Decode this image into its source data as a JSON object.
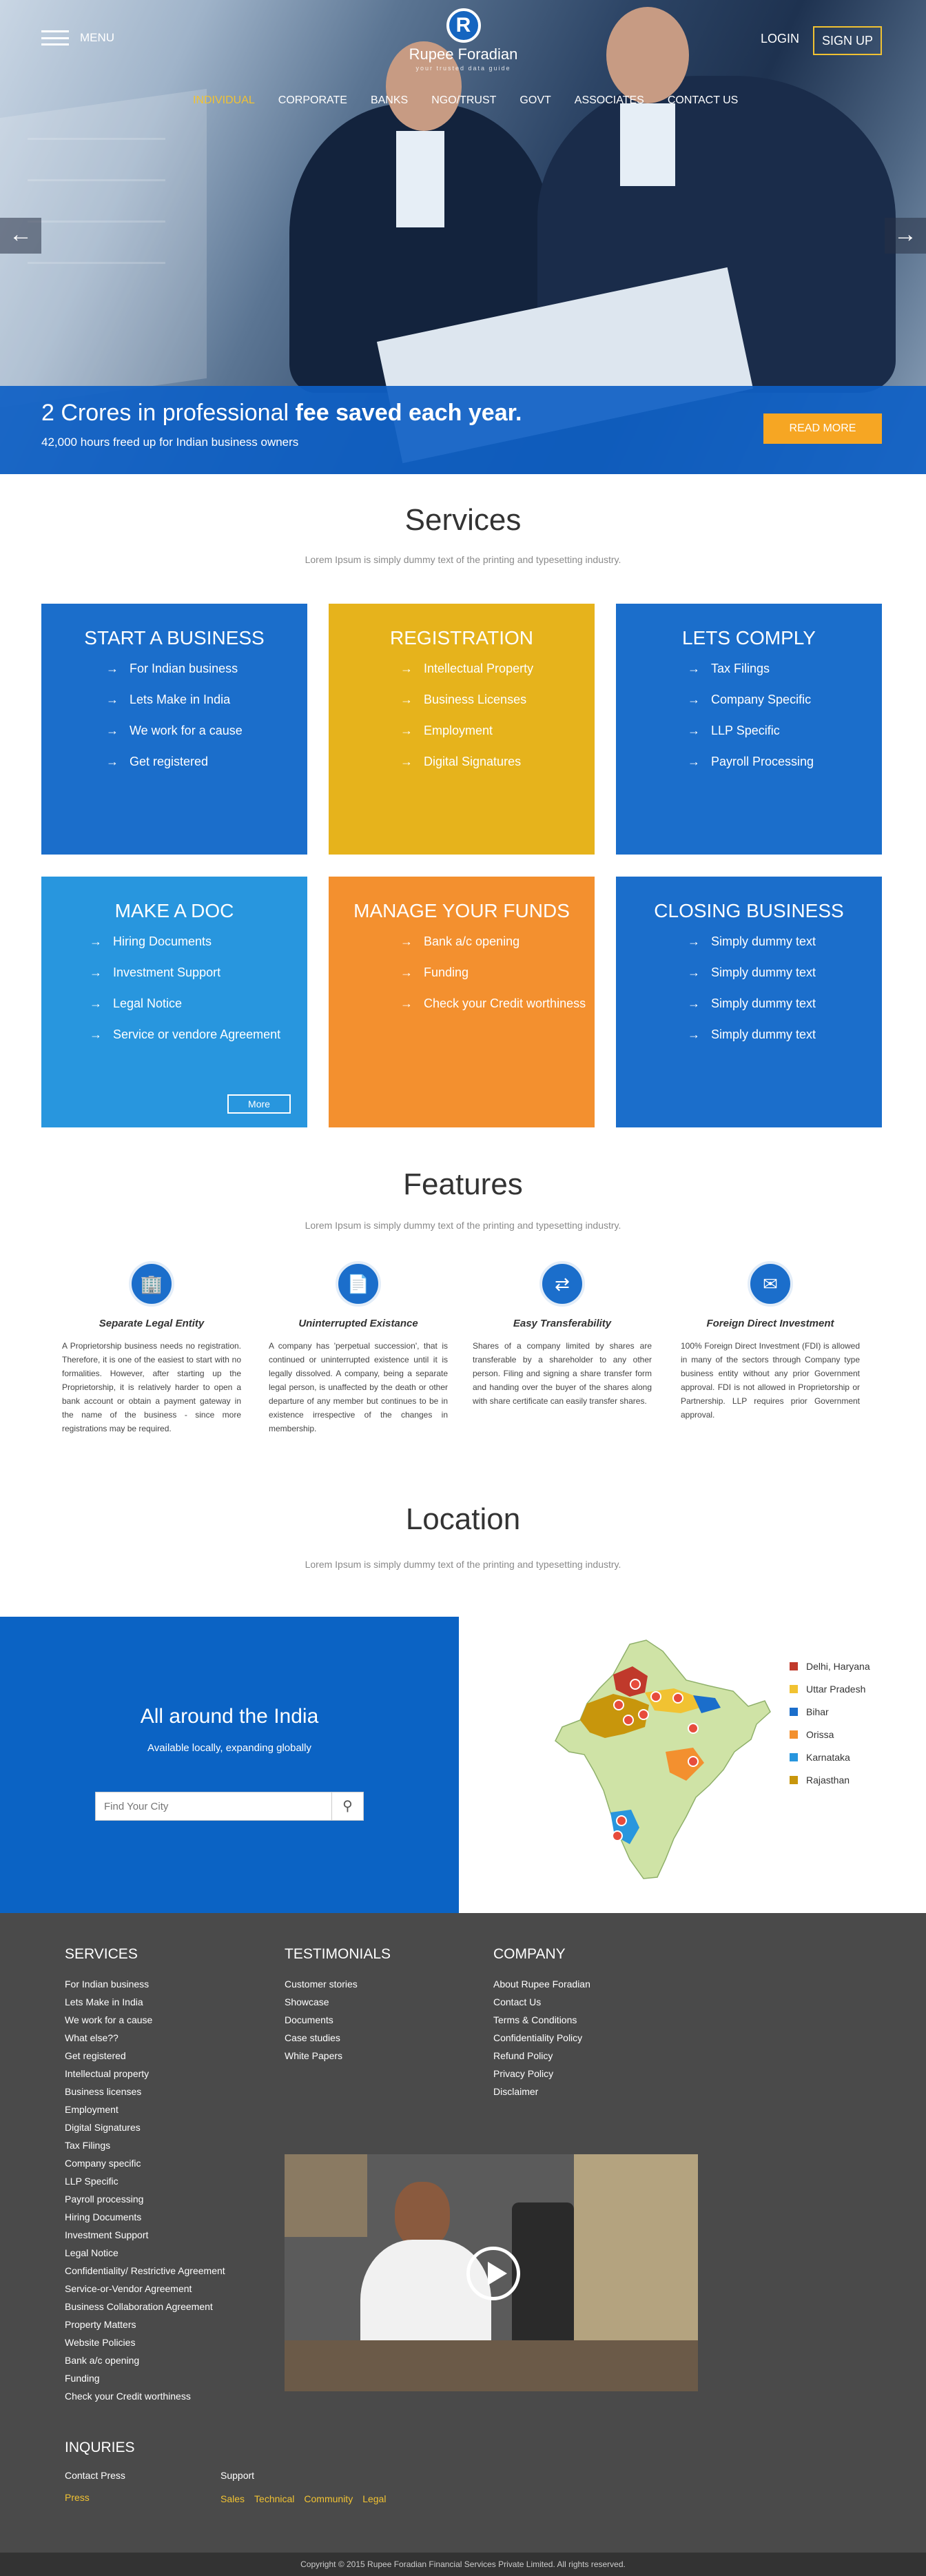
{
  "header": {
    "menu_label": "MENU",
    "logo_letter": "R",
    "logo_name": "Rupee Foradian",
    "logo_tagline": "your trusted data guide",
    "login": "LOGIN",
    "signup": "SIGN UP"
  },
  "nav": {
    "items": [
      "INDIVIDUAL",
      "CORPORATE",
      "BANKS",
      "NGO/TRUST",
      "GOVT",
      "ASSOCIATES",
      "CONTACT US"
    ],
    "active": "INDIVIDUAL"
  },
  "banner": {
    "headline_light": "2 Crores in professional",
    "headline_bold": "fee saved each year.",
    "subtext": "42,000 hours freed up for Indian business owners",
    "cta": "READ MORE"
  },
  "services": {
    "title": "Services",
    "subtitle": "Lorem Ipsum is simply dummy text of the printing and typesetting industry.",
    "cards": [
      {
        "title": "START A BUSINESS",
        "color": "#1b6ecb",
        "items": [
          "For Indian business",
          "Lets Make in India",
          "We work for a cause",
          "Get registered"
        ]
      },
      {
        "title": "REGISTRATION",
        "color": "#e6b31c",
        "items": [
          "Intellectual Property",
          "Business Licenses",
          "Employment",
          "Digital Signatures"
        ]
      },
      {
        "title": "LETS COMPLY",
        "color": "#1b6ecb",
        "items": [
          "Tax Filings",
          "Company Specific",
          "LLP Specific",
          "Payroll Processing"
        ]
      },
      {
        "title": "MAKE A DOC",
        "color": "#2896de",
        "items": [
          "Hiring Documents",
          "Investment Support",
          "Legal Notice",
          "Service or vendore Agreement"
        ],
        "more": "More"
      },
      {
        "title": "MANAGE YOUR FUNDS",
        "color": "#f3902f",
        "items": [
          "Bank a/c opening",
          "Funding",
          "Check your Credit worthiness"
        ]
      },
      {
        "title": "CLOSING BUSINESS",
        "color": "#1b6ecb",
        "items": [
          "Simply dummy text",
          "Simply dummy text",
          "Simply dummy text",
          "Simply dummy text"
        ]
      }
    ]
  },
  "features": {
    "title": "Features",
    "subtitle": "Lorem Ipsum is simply dummy text of the printing and typesetting industry.",
    "items": [
      {
        "icon": "building-icon",
        "title": "Separate Legal Entity",
        "text": "A Proprietorship business needs no registration. Therefore, it is one of the easiest to start with no formalities. However, after starting up the Proprietorship, it is relatively harder to open a bank account or obtain a payment gateway in the name of the business - since more registrations may be required."
      },
      {
        "icon": "document-icon",
        "title": "Uninterrupted Existance",
        "text": "A company has 'perpetual succession', that is continued or uninterrupted existence until it is legally dissolved. A company, being a separate legal person, is unaffected by the death or other departure of any member but continues to be in existence irrespective of the changes in membership."
      },
      {
        "icon": "transfer-icon",
        "title": "Easy Transferability",
        "text": "Shares of a company limited by shares are transferable by a shareholder to any other person. Filing and signing a share transfer form and handing over the buyer of the shares along with share certificate can easily transfer shares."
      },
      {
        "icon": "investment-icon",
        "title": "Foreign Direct Investment",
        "text": "100% Foreign Direct Investment (FDI) is allowed in many of the sectors through Company type business entity without any prior Government approval. FDI is not allowed in Proprietorship or Partnership. LLP requires prior Government approval."
      }
    ]
  },
  "location": {
    "title": "Location",
    "subtitle": "Lorem Ipsum is simply dummy text of the printing and typesetting industry.",
    "panel_title": "All around the India",
    "panel_sub": "Available locally, expanding globally",
    "search_placeholder": "Find Your City",
    "legend": [
      {
        "label": "Delhi, Haryana",
        "color": "#c0392b"
      },
      {
        "label": "Uttar Pradesh",
        "color": "#f1c232"
      },
      {
        "label": "Bihar",
        "color": "#1b6ecb"
      },
      {
        "label": "Orissa",
        "color": "#f3902f"
      },
      {
        "label": "Karnataka",
        "color": "#2896de"
      },
      {
        "label": "Rajasthan",
        "color": "#c8960c"
      }
    ]
  },
  "footer": {
    "services_title": "SERVICES",
    "services": [
      "For Indian business",
      "Lets Make in India",
      "We work for a cause",
      "What else??",
      "Get registered",
      "Intellectual property",
      "Business licenses",
      "Employment",
      "Digital Signatures",
      "Tax Filings",
      "Company specific",
      "LLP Specific",
      "Payroll processing",
      "Hiring Documents",
      "Investment Support",
      "Legal Notice",
      "Confidentiality/ Restrictive Agreement",
      "Service-or-Vendor Agreement",
      "Business Collaboration Agreement",
      "Property Matters",
      "Website Policies",
      "Bank a/c opening",
      "Funding",
      "Check your Credit worthiness"
    ],
    "testimonials_title": "TESTIMONIALS",
    "testimonials": [
      "Customer stories",
      "Showcase",
      "Documents",
      "Case studies",
      "White Papers"
    ],
    "company_title": "COMPANY",
    "company": [
      "About Rupee Foradian",
      "Contact Us",
      "Terms & Conditions",
      "Confidentiality Policy",
      "Refund Policy",
      "Privacy Policy",
      "Disclaimer"
    ],
    "inquiries_title": "INQURIES",
    "contact_press": "Contact Press",
    "press": "Press",
    "support": "Support",
    "support_links": [
      "Sales",
      "Technical",
      "Community",
      "Legal"
    ],
    "copyright": "Copyright © 2015 Rupee Foradian Financial Services Private Limited. All rights reserved."
  }
}
